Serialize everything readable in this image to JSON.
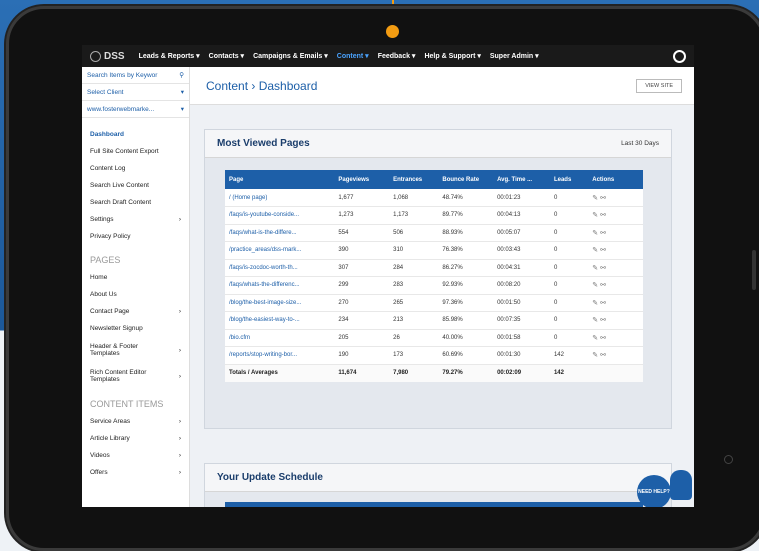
{
  "nav": {
    "logo": "DSS",
    "items": [
      "Leads & Reports ▾",
      "Contacts ▾",
      "Campaigns & Emails ▾",
      "Content ▾",
      "Feedback ▾",
      "Help & Support ▾",
      "Super Admin ▾"
    ],
    "active_index": 3
  },
  "sidebar": {
    "search_placeholder": "Search Items by Keywor",
    "select_client": "Select Client",
    "site": "www.fosterwebmarke...",
    "links": [
      "Dashboard",
      "Full Site Content Export",
      "Content Log",
      "Search Live Content",
      "Search Draft Content",
      "Settings",
      "Privacy Policy"
    ],
    "pages_heading": "PAGES",
    "pages": [
      "Home",
      "About Us",
      "Contact Page",
      "Newsletter Signup",
      "Header & Footer Templates",
      "Rich Content Editor Templates"
    ],
    "content_heading": "CONTENT ITEMS",
    "content_items": [
      "Service Areas",
      "Article Library",
      "Videos",
      "Offers"
    ]
  },
  "header": {
    "breadcrumb": "Content › Dashboard",
    "view_site": "VIEW SITE"
  },
  "most_viewed": {
    "title": "Most Viewed Pages",
    "range": "Last 30 Days",
    "columns": [
      "Page",
      "Pageviews",
      "Entrances",
      "Bounce Rate",
      "Avg. Time ...",
      "Leads",
      "Actions"
    ],
    "rows": [
      [
        "/ (Home page)",
        "1,677",
        "1,068",
        "48.74%",
        "00:01:23",
        "0"
      ],
      [
        "/faqs/is-youtube-conside...",
        "1,273",
        "1,173",
        "89.77%",
        "00:04:13",
        "0"
      ],
      [
        "/faqs/what-is-the-differe...",
        "554",
        "506",
        "88.93%",
        "00:05:07",
        "0"
      ],
      [
        "/practice_areas/dss-mark...",
        "390",
        "310",
        "76.38%",
        "00:03:43",
        "0"
      ],
      [
        "/faqs/is-zocdoc-worth-th...",
        "307",
        "284",
        "86.27%",
        "00:04:31",
        "0"
      ],
      [
        "/faqs/whats-the-differenc...",
        "299",
        "283",
        "92.93%",
        "00:08:20",
        "0"
      ],
      [
        "/blog/the-best-image-size...",
        "270",
        "265",
        "97.36%",
        "00:01:50",
        "0"
      ],
      [
        "/blog/the-easiest-way-to-...",
        "234",
        "213",
        "85.98%",
        "00:07:35",
        "0"
      ],
      [
        "/bio.cfm",
        "205",
        "26",
        "40.00%",
        "00:01:58",
        "0"
      ],
      [
        "/reports/stop-writing-bor...",
        "190",
        "173",
        "60.69%",
        "00:01:30",
        "142"
      ]
    ],
    "totals": [
      "Totals / Averages",
      "11,674",
      "7,980",
      "79.27%",
      "00:02:09",
      "142"
    ]
  },
  "schedule": {
    "title": "Your Update Schedule"
  },
  "help": {
    "label": "NEED HELP?"
  }
}
